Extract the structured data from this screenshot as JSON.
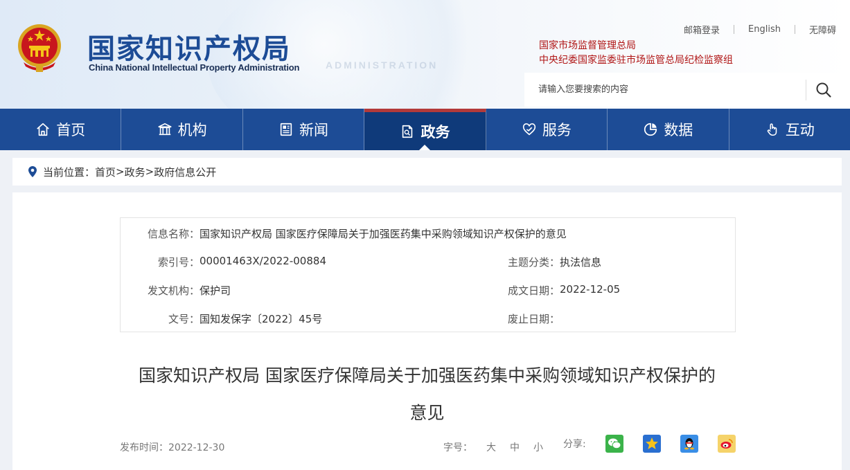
{
  "header": {
    "title": "国家知识产权局",
    "subtitle": "China National Intellectual Property Administration",
    "deco_text": "ADMINISTRATION",
    "top_links": [
      "邮箱登录",
      "English",
      "无障碍"
    ],
    "org_links": [
      "国家市场监督管理总局",
      "中央纪委国家监委驻市场监管总局纪检监察组"
    ],
    "search_placeholder": "请输入您要搜索的内容"
  },
  "nav": {
    "items": [
      {
        "label": "首页",
        "icon": "home-icon"
      },
      {
        "label": "机构",
        "icon": "institution-icon"
      },
      {
        "label": "新闻",
        "icon": "news-icon"
      },
      {
        "label": "政务",
        "icon": "document-icon",
        "active": true
      },
      {
        "label": "服务",
        "icon": "service-icon"
      },
      {
        "label": "数据",
        "icon": "data-icon"
      },
      {
        "label": "互动",
        "icon": "interaction-icon"
      }
    ]
  },
  "breadcrumb": {
    "label": "当前位置：",
    "items": [
      "首页",
      "政务",
      "政府信息公开"
    ],
    "separator": ">"
  },
  "info": {
    "name_label": "信息名称：",
    "name_value": "国家知识产权局 国家医疗保障局关于加强医药集中采购领域知识产权保护的意见",
    "index_label": "索引号：",
    "index_value": "00001463X/2022-00884",
    "topic_label": "主题分类：",
    "topic_value": "执法信息",
    "issuer_label": "发文机构：",
    "issuer_value": "保护司",
    "date_label": "成文日期：",
    "date_value": "2022-12-05",
    "docno_label": "文号：",
    "docno_value": "国知发保字〔2022〕45号",
    "expiry_label": "废止日期：",
    "expiry_value": ""
  },
  "article": {
    "title_line1": "国家知识产权局 国家医疗保障局关于加强医药集中采购领域知识产权保护的",
    "title_line2": "意见",
    "publish_label": "发布时间：",
    "publish_date": "2022-12-30",
    "font_label": "字号：",
    "font_sizes": [
      "大",
      "中",
      "小"
    ],
    "share_label": "分享:"
  },
  "colors": {
    "brand_blue": "#1d4c96",
    "nav_active": "#0f3a7a",
    "accent_red": "#b01515"
  }
}
